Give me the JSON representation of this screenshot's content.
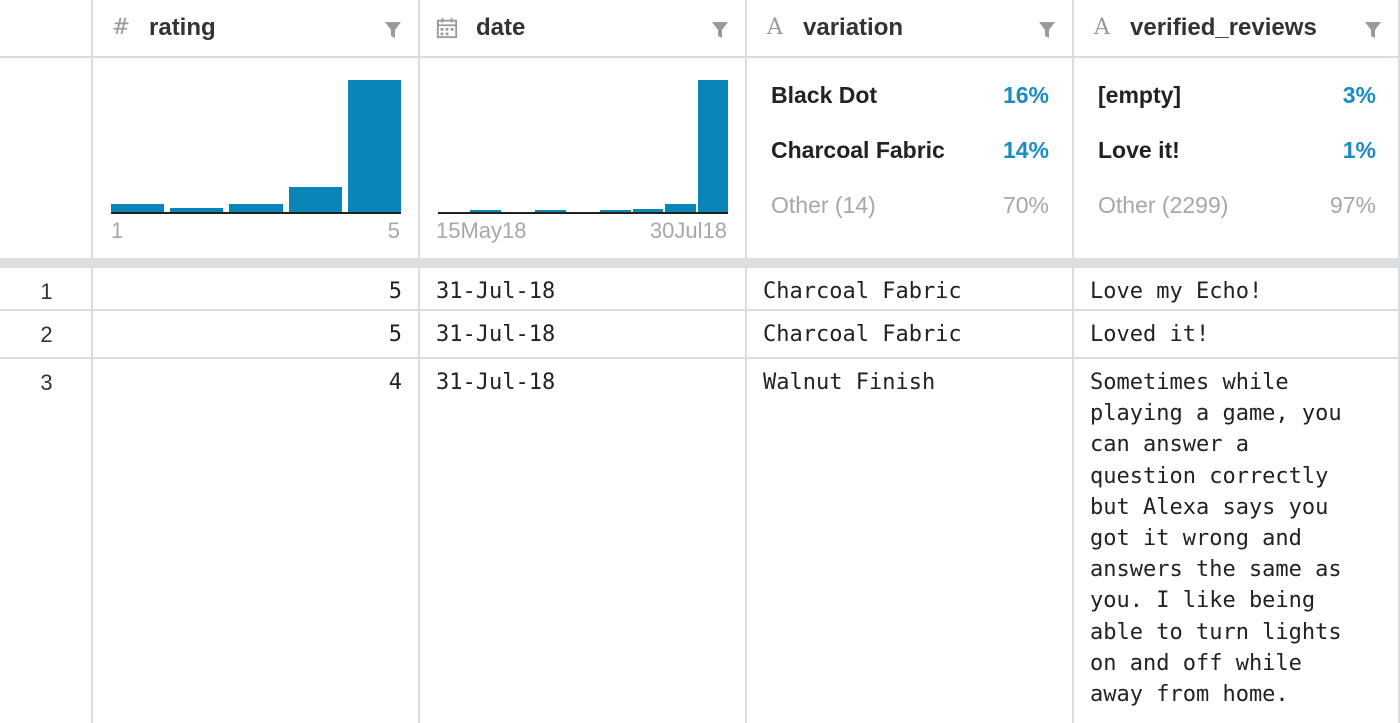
{
  "columns": [
    {
      "icon": "#",
      "icon_name": "number-type-icon",
      "name": "rating"
    },
    {
      "icon": "date",
      "icon_name": "calendar-icon",
      "name": "date"
    },
    {
      "icon": "A",
      "icon_name": "text-type-icon",
      "name": "variation"
    },
    {
      "icon": "A",
      "icon_name": "text-type-icon",
      "name": "verified_reviews"
    }
  ],
  "summary": {
    "rating": {
      "hist_relative_heights": [
        0.06,
        0.03,
        0.06,
        0.19,
        1.0
      ],
      "min_label": "1",
      "max_label": "5"
    },
    "date": {
      "hist_relative_heights": [
        0.0,
        0.01,
        0.0,
        0.01,
        0.0,
        0.01,
        0.02,
        0.06,
        1.0
      ],
      "min_label": "15May18",
      "max_label": "30Jul18"
    },
    "variation": [
      {
        "label": "Black Dot",
        "pct": "16%"
      },
      {
        "label": "Charcoal Fabric",
        "pct": "14%"
      },
      {
        "label": "Other (14)",
        "pct": "70%",
        "other": true
      }
    ],
    "verified_reviews": [
      {
        "label": "[empty]",
        "pct": "3%"
      },
      {
        "label": "Love it!",
        "pct": "1%"
      },
      {
        "label": "Other (2299)",
        "pct": "97%",
        "other": true
      }
    ]
  },
  "rows": [
    {
      "n": "1",
      "rating": "5",
      "date": "31-Jul-18",
      "variation": "Charcoal Fabric",
      "verified_reviews": "Love my Echo!"
    },
    {
      "n": "2",
      "rating": "5",
      "date": "31-Jul-18",
      "variation": "Charcoal Fabric",
      "verified_reviews": "Loved it!"
    },
    {
      "n": "3",
      "rating": "4",
      "date": "31-Jul-18",
      "variation": "Walnut Finish",
      "verified_reviews": "Sometimes while\nplaying a game, you\ncan answer a\nquestion correctly\nbut Alexa says you\ngot it wrong and\nanswers the same as\nyou. I like being\nable to turn lights\non and off while\naway from home."
    }
  ],
  "colors": {
    "accent": "#0a85b8",
    "percent": "#1a8cc0",
    "muted": "#a7a7a7",
    "border": "#d9dde0"
  }
}
